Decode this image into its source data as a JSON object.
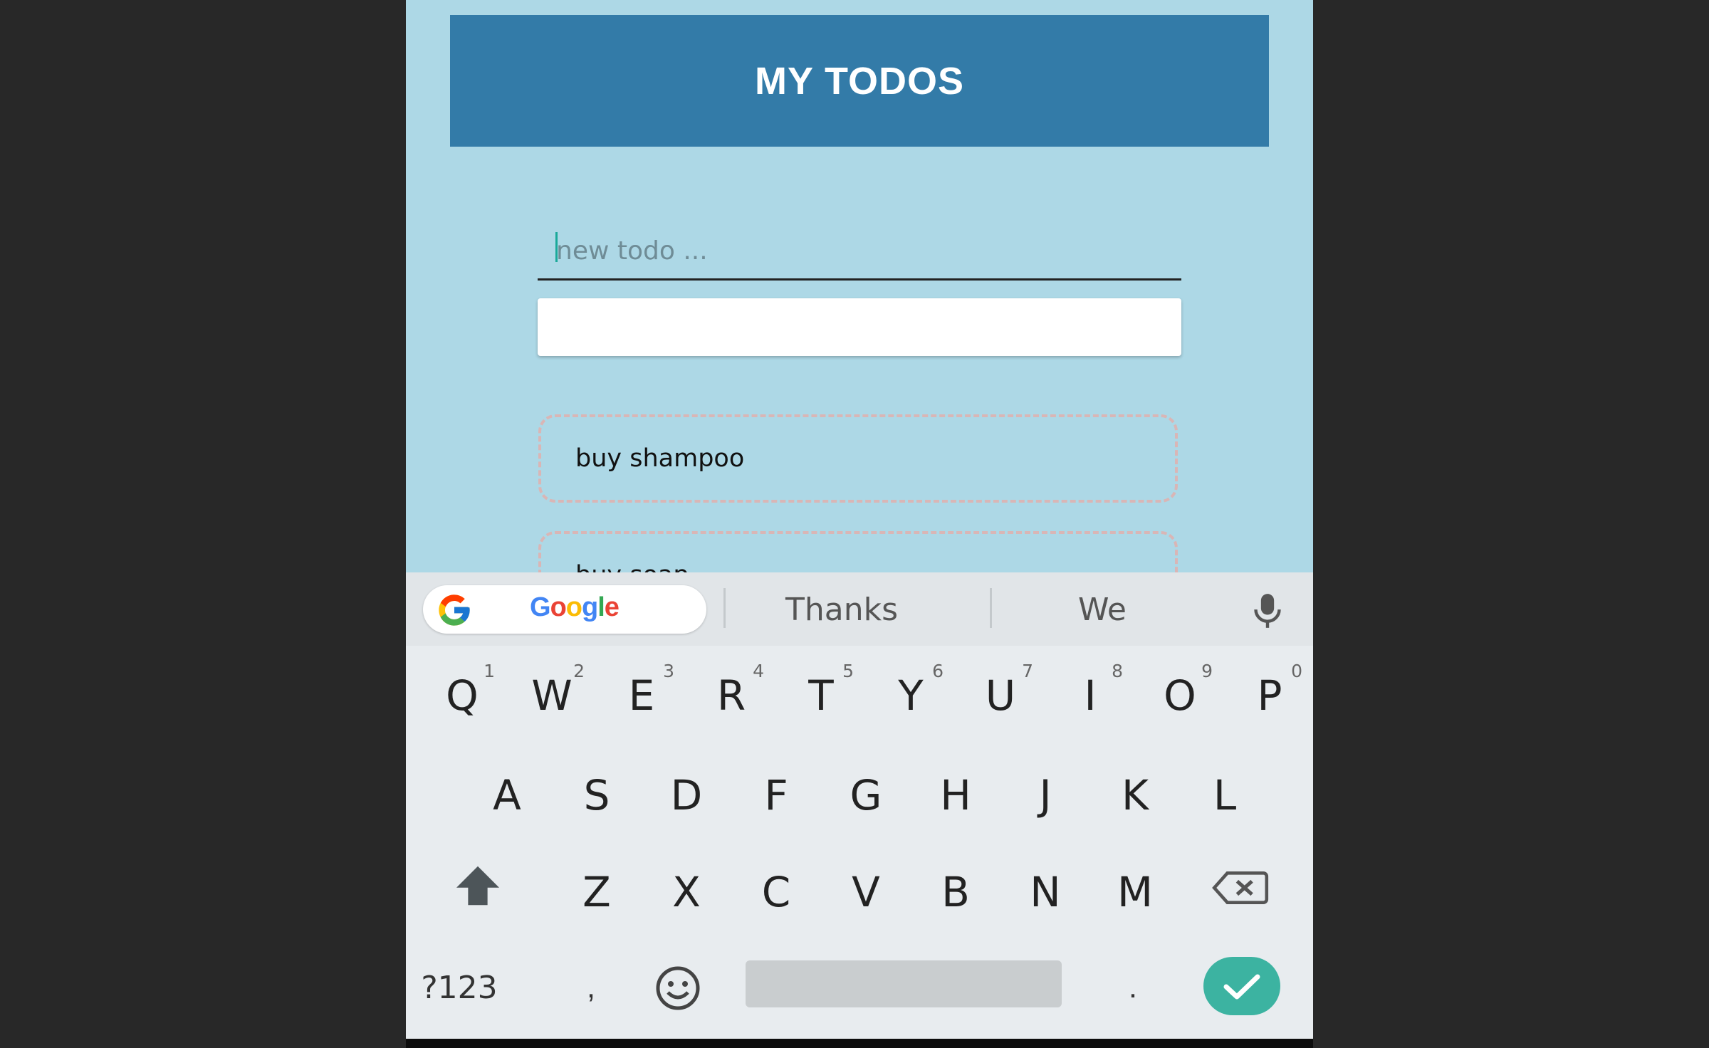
{
  "app": {
    "title": "MY TODOS"
  },
  "input": {
    "placeholder": "new todo ...",
    "value": ""
  },
  "todos": [
    {
      "text": "buy shampoo"
    },
    {
      "text": "buy soap"
    }
  ],
  "keyboard": {
    "google_label": "Google",
    "suggestions": [
      "Thanks",
      "We"
    ],
    "row1": [
      {
        "key": "Q",
        "hint": "1"
      },
      {
        "key": "W",
        "hint": "2"
      },
      {
        "key": "E",
        "hint": "3"
      },
      {
        "key": "R",
        "hint": "4"
      },
      {
        "key": "T",
        "hint": "5"
      },
      {
        "key": "Y",
        "hint": "6"
      },
      {
        "key": "U",
        "hint": "7"
      },
      {
        "key": "I",
        "hint": "8"
      },
      {
        "key": "O",
        "hint": "9"
      },
      {
        "key": "P",
        "hint": "0"
      }
    ],
    "row2": [
      "A",
      "S",
      "D",
      "F",
      "G",
      "H",
      "J",
      "K",
      "L"
    ],
    "row3": [
      "Z",
      "X",
      "C",
      "V",
      "B",
      "N",
      "M"
    ],
    "symbols_label": "?123",
    "comma": ",",
    "period": ".",
    "icons": [
      "google-g-icon",
      "mic-icon",
      "shift-icon",
      "backspace-icon",
      "emoji-icon",
      "check-icon"
    ],
    "enter_color": "#3cb3a1"
  },
  "colors": {
    "background": "#add8e6",
    "header": "#337ba8"
  }
}
